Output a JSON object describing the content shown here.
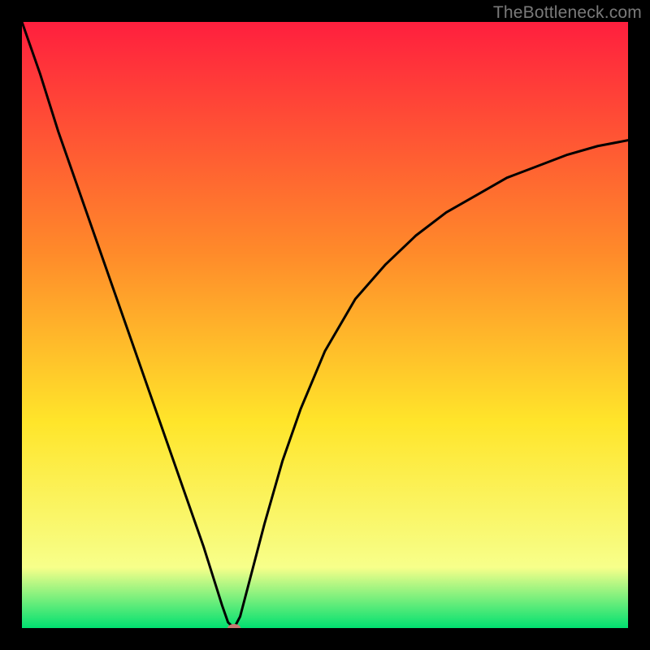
{
  "watermark": "TheBottleneck.com",
  "chart_data": {
    "type": "line",
    "title": "",
    "xlabel": "",
    "ylabel": "",
    "xlim": [
      0,
      100
    ],
    "ylim": [
      0,
      105
    ],
    "grid": false,
    "legend": null,
    "background_gradient": {
      "top": "#ff1f3e",
      "mid_upper": "#ff8a2a",
      "mid": "#ffe52a",
      "lower": "#f7ff8a",
      "bottom": "#00e070"
    },
    "series": [
      {
        "name": "curve",
        "color": "#000000",
        "x": [
          0,
          3,
          6,
          9,
          12,
          15,
          18,
          21,
          24,
          27,
          30,
          33,
          34,
          35,
          36,
          37,
          38,
          40,
          43,
          46,
          50,
          55,
          60,
          65,
          70,
          75,
          80,
          85,
          90,
          95,
          100
        ],
        "y": [
          105,
          96,
          86,
          77,
          68,
          59,
          50,
          41,
          32,
          23,
          14,
          4,
          1,
          0,
          2,
          6,
          10,
          18,
          29,
          38,
          48,
          57,
          63,
          68,
          72,
          75,
          78,
          80,
          82,
          83.5,
          84.5
        ]
      }
    ],
    "marker": {
      "name": "min-marker",
      "x": 35,
      "y": 0,
      "color": "#c87a72",
      "rx": 8,
      "ry": 5
    }
  }
}
